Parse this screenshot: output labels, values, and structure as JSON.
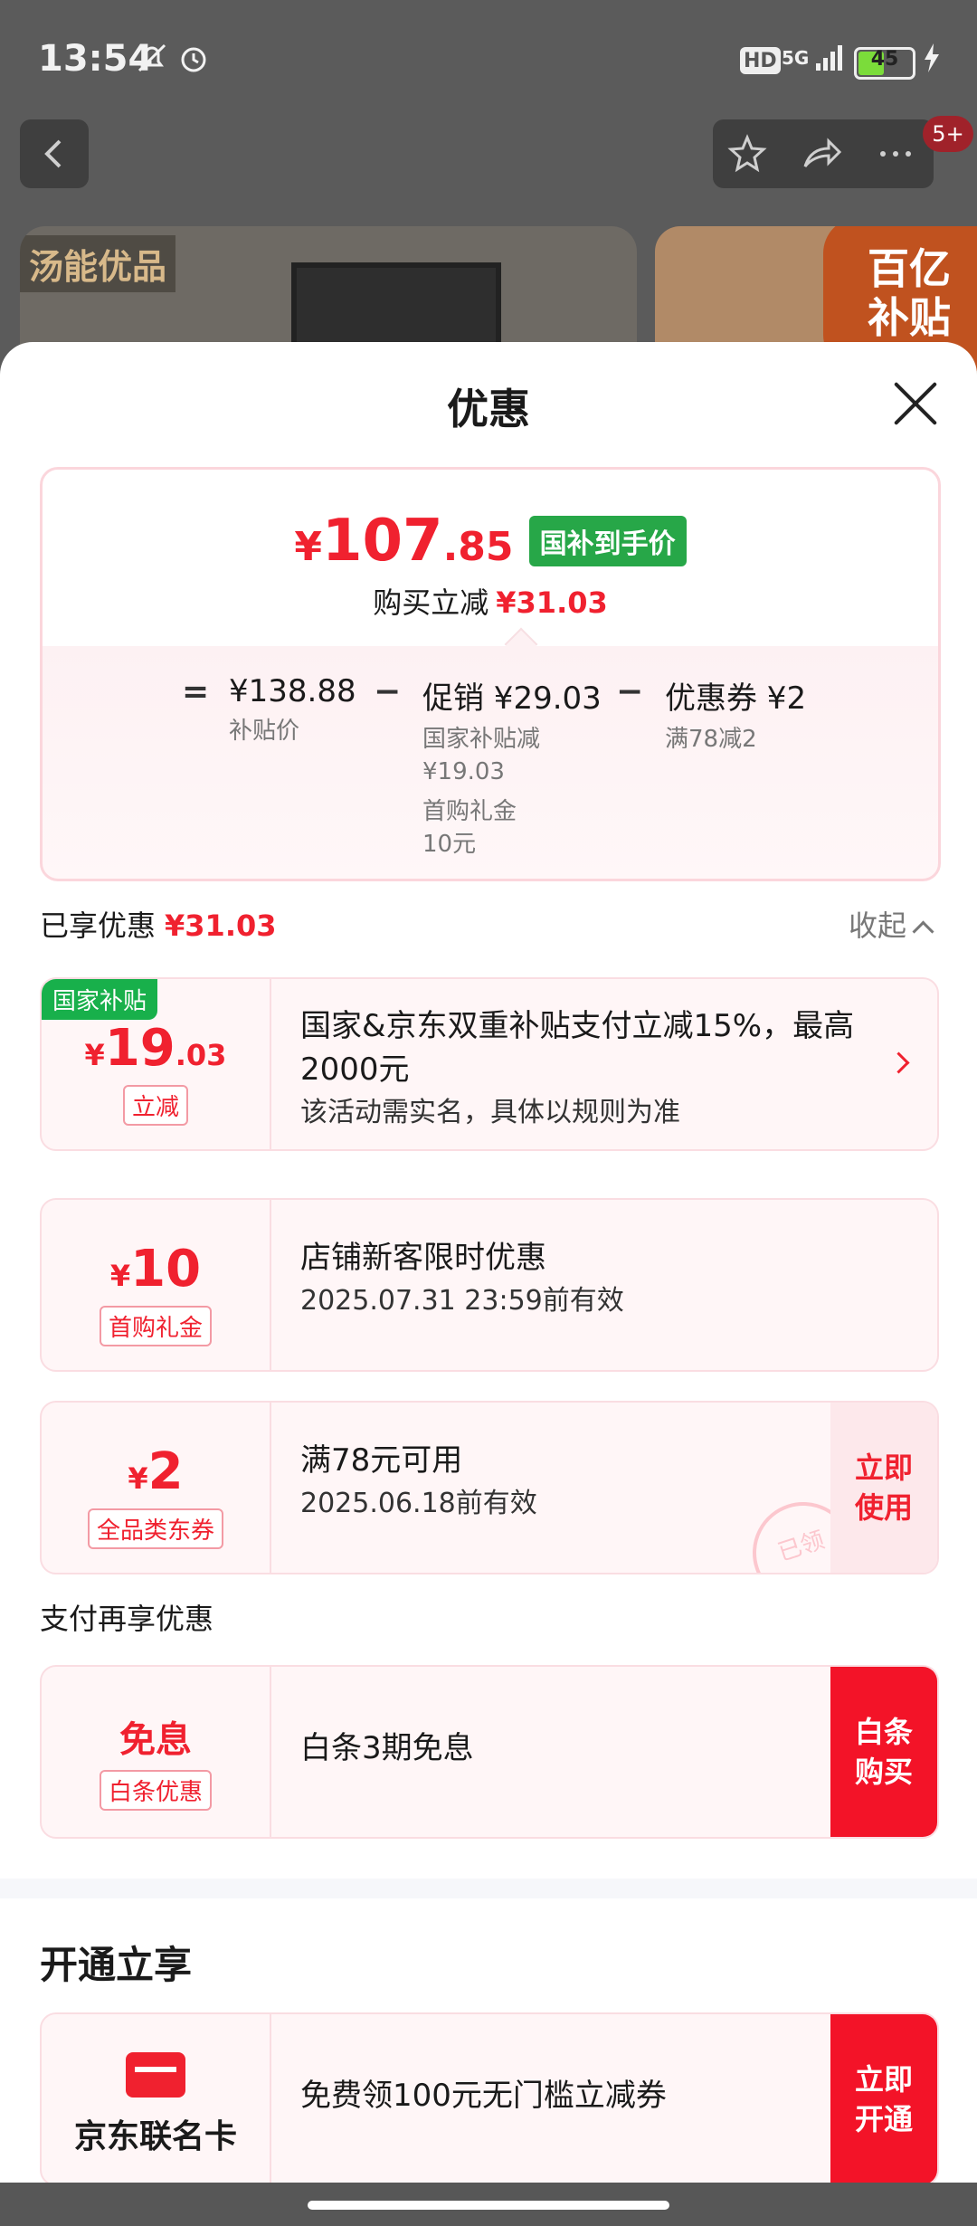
{
  "status_bar": {
    "time": "13:54",
    "hd": "HD",
    "network": "5G",
    "battery": "45"
  },
  "background": {
    "badge_count": "5+",
    "hero_left_tag": "汤能优品",
    "hero_right_tag": "百亿\n补贴"
  },
  "sheet": {
    "title": "优惠",
    "summary": {
      "price_yen": "¥",
      "price_int": "107",
      "price_dec": ".85",
      "price_tag": "国补到手价",
      "reduce_label": "购买立减",
      "reduce_amount": "¥31.03",
      "eq": "=",
      "minus": "−",
      "base_price": "¥138.88",
      "base_label": "补贴价",
      "promo_main": "促销 ¥29.03",
      "promo_sub1": "国家补贴减",
      "promo_sub1_val": "¥19.03",
      "promo_sub2": "首购礼金",
      "promo_sub2_val": "10元",
      "coupon_main": "优惠券 ¥2",
      "coupon_sub": "满78减2"
    },
    "enjoyed_label": "已享优惠",
    "enjoyed_amount": "¥31.03",
    "collapse_label": "收起",
    "offers": [
      {
        "corner_tag": "国家补贴",
        "yen": "¥",
        "big": "19",
        "small": ".03",
        "pill": "立减",
        "line1": "国家&京东双重补贴支付立减15%，最高2000元",
        "line2": "该活动需实名，具体以规则为准"
      },
      {
        "yen": "¥",
        "big": "10",
        "pill": "首购礼金",
        "line1": "店铺新客限时优惠",
        "line2": "2025.07.31 23:59前有效"
      },
      {
        "yen": "¥",
        "big": "2",
        "pill": "全品类东券",
        "line1": "满78元可用",
        "line2": "2025.06.18前有效",
        "action": "立即\n使用",
        "stamp": "已领"
      }
    ],
    "pay_title": "支付再享优惠",
    "pay_offer": {
      "big": "免息",
      "pill": "白条优惠",
      "line1": "白条3期免息",
      "action": "白条\n购买"
    },
    "open_title": "开通立享",
    "open_offer": {
      "name": "京东联名卡",
      "line1": "免费领100元无门槛立减券",
      "action": "立即\n开通"
    }
  }
}
